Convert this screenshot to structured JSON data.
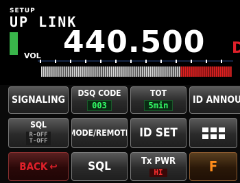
{
  "display": {
    "mode_label": "SETUP",
    "title": "UP LINK",
    "volume_label": "VOL",
    "frequency": "440.500",
    "band_indicator": "D",
    "level_color": "#39b54a",
    "meter_fill_fraction": 0.27
  },
  "buttons": {
    "signaling": {
      "label": "SIGNALING"
    },
    "dsq_code": {
      "label": "DSQ CODE",
      "value": "003"
    },
    "tot": {
      "label": "TOT",
      "value": "5min"
    },
    "id_announce": {
      "label": "ID ANNOUNC"
    },
    "sql_type": {
      "label": "SQL",
      "value_line1": "R-OFF",
      "value_line2": "T-OFF"
    },
    "mode_remote": {
      "label": "MODE/REMOTE"
    },
    "id_set": {
      "label": "ID SET"
    },
    "menu_grid": {
      "icon": "grid-icon"
    },
    "back": {
      "label": "BACK"
    },
    "sql": {
      "label": "SQL"
    },
    "tx_pwr": {
      "label": "Tx PWR",
      "value": "HI"
    },
    "function": {
      "label": "F"
    }
  },
  "colors": {
    "accent_green": "#33ff66",
    "accent_red": "#e0202a",
    "accent_orange": "#ff8c1a"
  }
}
